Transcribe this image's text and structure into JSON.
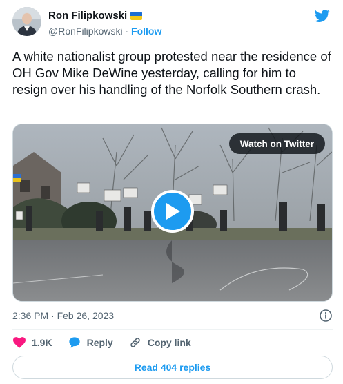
{
  "author": {
    "display_name": "Ron Filipkowski",
    "flag_icon": "ukraine-flag-icon",
    "handle": "@RonFilipkowski",
    "separator": " · ",
    "follow_label": "Follow"
  },
  "tweet": {
    "text": "A white nationalist group protested near the residence of OH Gov Mike DeWine yesterday, calling for him to resign over his handling of the Norfolk Southern crash."
  },
  "media": {
    "watch_label": "Watch on Twitter",
    "play_icon": "play-icon"
  },
  "meta": {
    "timestamp": "2:36 PM · Feb 26, 2023",
    "info_icon": "info-icon"
  },
  "actions": {
    "likes_count": "1.9K",
    "reply_label": "Reply",
    "copy_link_label": "Copy link"
  },
  "read_replies_label": "Read 404 replies",
  "colors": {
    "accent": "#1d9bf0",
    "like": "#f91880",
    "text": "#0f1419",
    "secondary": "#536471"
  }
}
